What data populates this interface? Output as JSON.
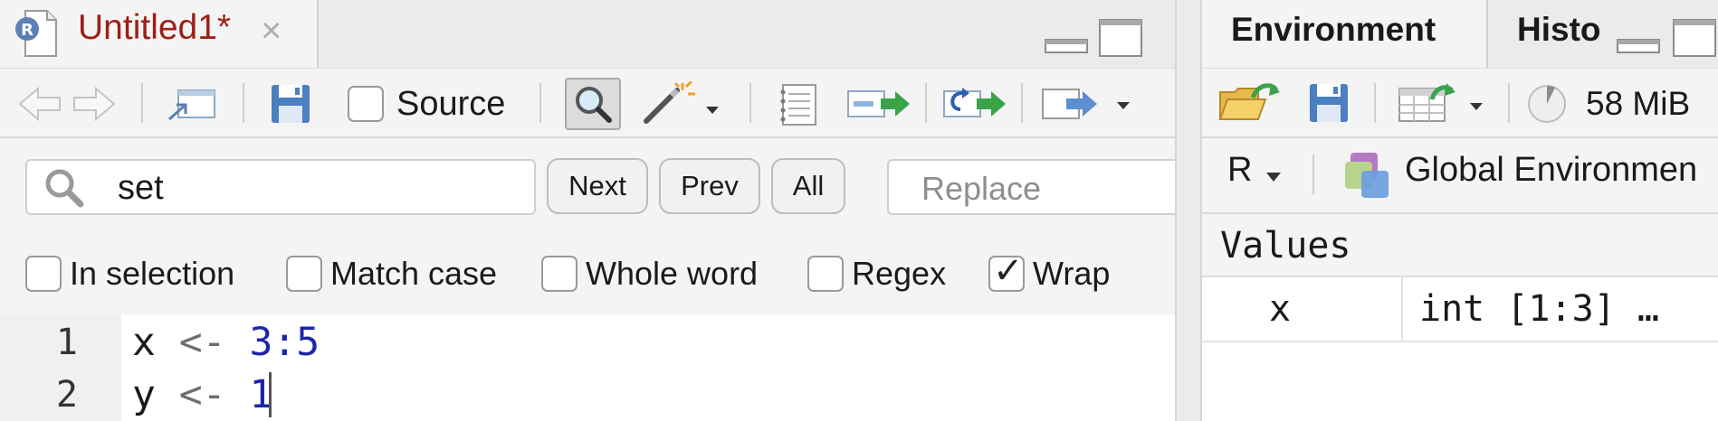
{
  "editor": {
    "tab_title": "Untitled1*",
    "tab_close_glyph": "×",
    "toolbar": {
      "source_label": "Source",
      "source_checked": false,
      "icons": [
        "back-arrow-icon",
        "forward-arrow-icon",
        "show-in-window-icon",
        "save-icon",
        "find-replace-icon",
        "code-tools-wand-icon",
        "compile-report-icon",
        "run-lines-icon",
        "rerun-icon",
        "source-file-icon"
      ]
    },
    "find": {
      "search_value": "set",
      "next_label": "Next",
      "prev_label": "Prev",
      "all_label": "All",
      "replace_placeholder": "Replace",
      "options": [
        {
          "label": "In selection",
          "checked": false
        },
        {
          "label": "Match case",
          "checked": false
        },
        {
          "label": "Whole word",
          "checked": false
        },
        {
          "label": "Regex",
          "checked": false
        },
        {
          "label": "Wrap",
          "checked": true
        }
      ]
    },
    "lines": [
      {
        "num": "1",
        "var": "x",
        "op": "<-",
        "val": "3:5"
      },
      {
        "num": "2",
        "var": "y",
        "op": "<-",
        "val": "1"
      }
    ]
  },
  "environment": {
    "tabs": [
      "Environment",
      "History"
    ],
    "tab_history_visible": "Histo",
    "memory": "58 MiB",
    "language": "R",
    "scope": "Global Environment",
    "scope_visible": "Global Environmen",
    "section": "Values",
    "variables": [
      {
        "name": "x",
        "value": "int [1:3] …"
      }
    ]
  },
  "colors": {
    "tab_title": "#9c1f18",
    "number": "#1d25a8",
    "operator": "#6e6e6e",
    "run_arrow": "#3aa34a",
    "save_blue": "#4a7fc0"
  }
}
